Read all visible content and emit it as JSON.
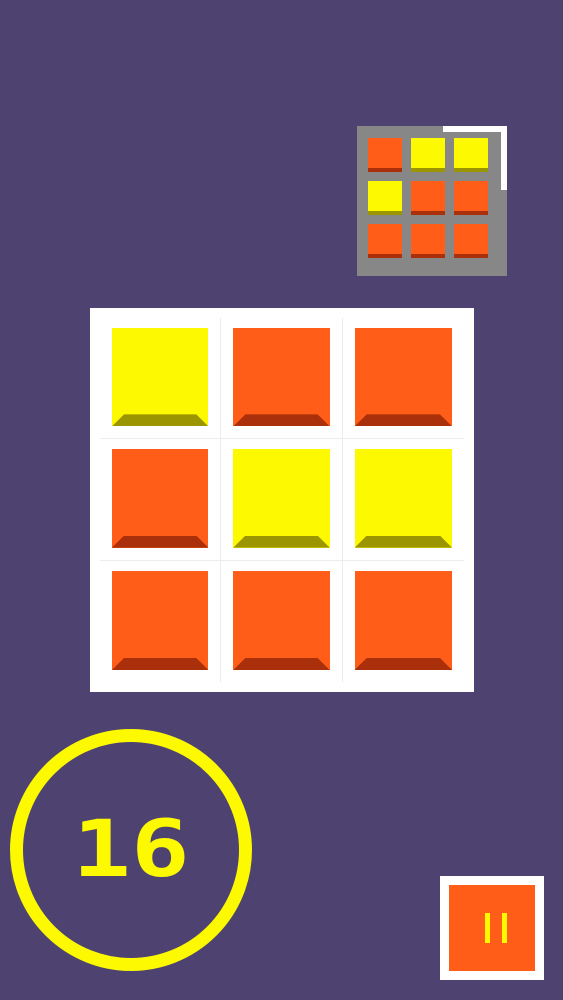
{
  "colors": {
    "background": "#4e4370",
    "board_bg": "#ffffff",
    "preview_bg": "#878787",
    "yellow": "#fdf900",
    "yellow_shadow": "#9a9500",
    "orange": "#ff5d18",
    "orange_shadow": "#a9300a",
    "counter_ring": "#fdf900",
    "pause_bg": "#ff5d18",
    "pause_frame": "#ffffff",
    "pause_bars": "#fdf900"
  },
  "target_pattern": [
    [
      "orange",
      "yellow",
      "yellow"
    ],
    [
      "yellow",
      "orange",
      "orange"
    ],
    [
      "orange",
      "orange",
      "orange"
    ]
  ],
  "board_tiles": [
    [
      "yellow",
      "orange",
      "orange"
    ],
    [
      "orange",
      "yellow",
      "yellow"
    ],
    [
      "orange",
      "orange",
      "orange"
    ]
  ],
  "moves_counter": "16",
  "pause_icon": "pause-icon"
}
